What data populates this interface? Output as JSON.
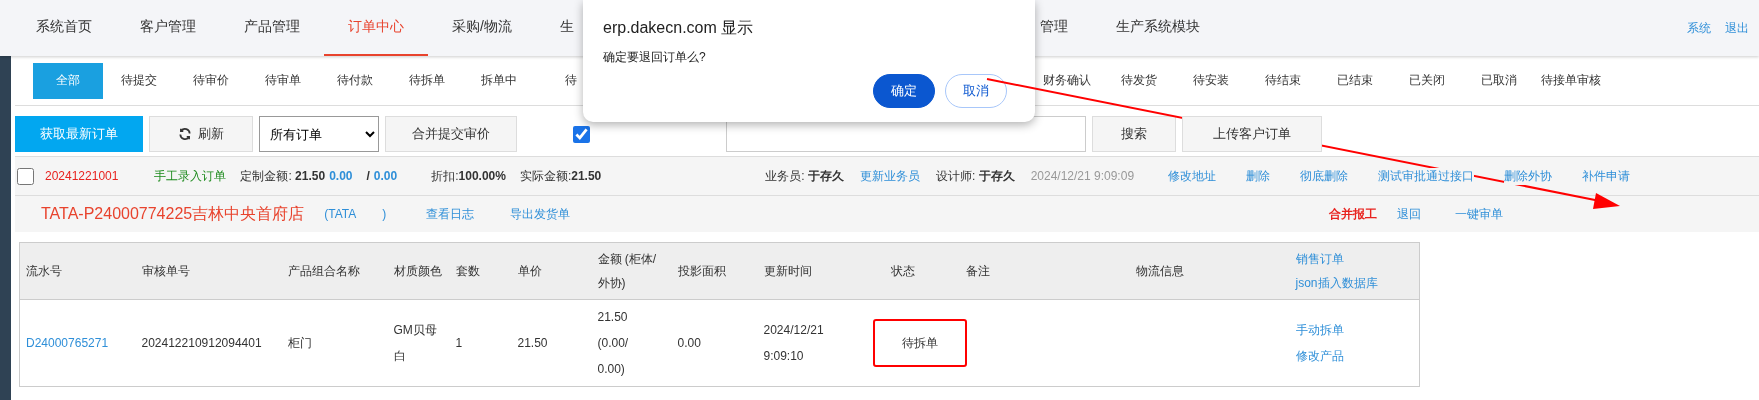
{
  "nav": {
    "left": [
      {
        "label": "系统首页",
        "selected": false
      },
      {
        "label": "客户管理",
        "selected": false
      },
      {
        "label": "产品管理",
        "selected": false
      },
      {
        "label": "订单中心",
        "selected": true
      },
      {
        "label": "采购/物流",
        "selected": false
      },
      {
        "label": "生",
        "selected": false
      }
    ],
    "right": [
      {
        "label": "管理",
        "selected": false
      },
      {
        "label": "生产系统模块",
        "selected": false
      }
    ],
    "user_links": [
      "系统",
      "退出"
    ]
  },
  "status_tabs": {
    "left": [
      {
        "label": "全部",
        "selected": true
      },
      {
        "label": "待提交",
        "selected": false
      },
      {
        "label": "待审价",
        "selected": false
      },
      {
        "label": "待审单",
        "selected": false
      },
      {
        "label": "待付款",
        "selected": false
      },
      {
        "label": "待拆单",
        "selected": false
      },
      {
        "label": "拆单中",
        "selected": false
      },
      {
        "label": "待",
        "selected": false
      }
    ],
    "right": [
      {
        "label": "财务确认",
        "selected": false
      },
      {
        "label": "待发货",
        "selected": false
      },
      {
        "label": "待安装",
        "selected": false
      },
      {
        "label": "待结束",
        "selected": false
      },
      {
        "label": "已结束",
        "selected": false
      },
      {
        "label": "已关闭",
        "selected": false
      },
      {
        "label": "已取消",
        "selected": false
      },
      {
        "label": "待接单审核",
        "selected": false
      }
    ]
  },
  "toolbar": {
    "fetch_button": "获取最新订单",
    "refresh_button": "刷新",
    "filter_value": "所有订单",
    "merge_button": "合并提交审价",
    "show_checkbox": {
      "checked": true
    },
    "search_button": "搜索",
    "upload_button": "上传客户订单"
  },
  "order": {
    "checked": false,
    "number": "20241221001",
    "source": "手工录入订单",
    "custom_amount": "定制金额: **21.50**",
    "amount_a": "0.00",
    "separator": "/",
    "amount_b": "0.00",
    "discount": "折扣:**100.00%**",
    "actual": "实际金额:**21.50**",
    "salesperson": "业务员: **于存久**",
    "update_salesperson": "更新业务员",
    "designer": "设计师: **于存久**",
    "time": "2024/12/21 9:09:09",
    "actions": [
      "修改地址",
      "删除",
      "彻底删除",
      "测试审批通过接口",
      "删除外协",
      "补件申请"
    ],
    "store": "TATA-P24000774225吉林中央首府店",
    "customer": "(TATA        )",
    "links": [
      "查看日志",
      "导出发货单"
    ],
    "merge_report": "合并报工",
    "right_links": [
      "退回",
      "一键审单"
    ]
  },
  "table": {
    "columns": [
      "流水号",
      "审核单号",
      "产品组合名称",
      "材质颜色",
      "套数",
      "单价",
      "金额 (柜体/外协)",
      "投影面积",
      "更新时间",
      "状态",
      "备注",
      "物流信息"
    ],
    "header_links": [
      "销售订单",
      "json插入数据库"
    ],
    "rows": [
      {
        "status_marked": true,
        "cells": [
          "D24000765271",
          "202412210912094401",
          "柜门",
          "GM贝母白",
          "1",
          "21.50",
          "21.50 (0.00/ 0.00)",
          "0.00",
          "2024/12/21 9:09:10",
          "待拆单",
          "",
          ""
        ],
        "actions": [
          "手动拆单",
          "修改产品"
        ]
      }
    ]
  },
  "dialog": {
    "title": "erp.dakecn.com 显示",
    "message": "确定要退回订单么?",
    "buttons": [
      {
        "label": "确定",
        "kind": "primary"
      },
      {
        "label": "取消",
        "kind": "secondary"
      }
    ]
  }
}
